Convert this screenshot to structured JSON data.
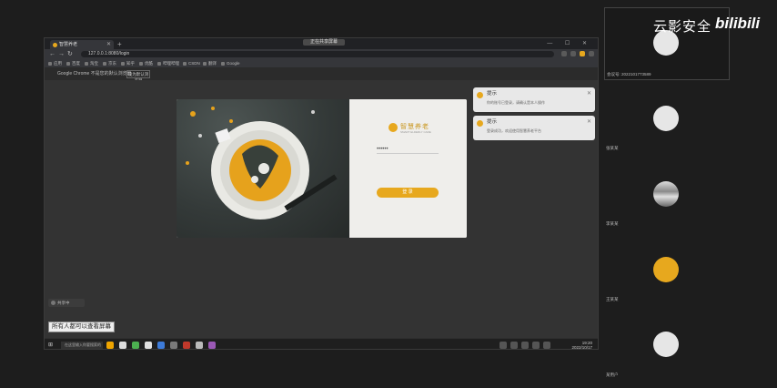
{
  "share": {
    "indicator_label": "正在共享屏幕"
  },
  "browser": {
    "tab_title": "智慧养老",
    "window_controls": "— ☐ ✕",
    "address": "127.0.0.1:8080/login",
    "bookmarks": [
      "应用",
      "百度",
      "淘宝",
      "京东",
      "知乎",
      "优酷",
      "哔哩哔哩",
      "CSDN",
      "翻译",
      "Google"
    ],
    "infobar_text": "Google Chrome 不是您的默认浏览器",
    "infobar_button": "设为默认浏览器"
  },
  "notifications": [
    {
      "title": "提示",
      "body": "你的账号已登录，请确认是本人操作"
    },
    {
      "title": "提示",
      "body": "登录成功，欢迎使用智慧养老平台"
    }
  ],
  "login": {
    "logo_name": "智慧养老",
    "logo_sub": "SMART ELDERLY CARE",
    "password_value": "••••••",
    "button_label": "登 录"
  },
  "overlay": {
    "chip_label": "共享中",
    "caption": "所有人都可以查看屏幕"
  },
  "taskbar": {
    "search_placeholder": "在这里输入你要搜索的内容",
    "time": "19:20",
    "date": "2022/10/17"
  },
  "panel": {
    "brand_text": "云影安全",
    "brand_logo": "bilibili",
    "self_label": "会议号: 2022101773589",
    "participants": [
      "张某某",
      "李某某",
      "王某某",
      "某用户"
    ]
  },
  "colors": {
    "accent": "#e7a81e",
    "background": "#1d1d1d"
  }
}
